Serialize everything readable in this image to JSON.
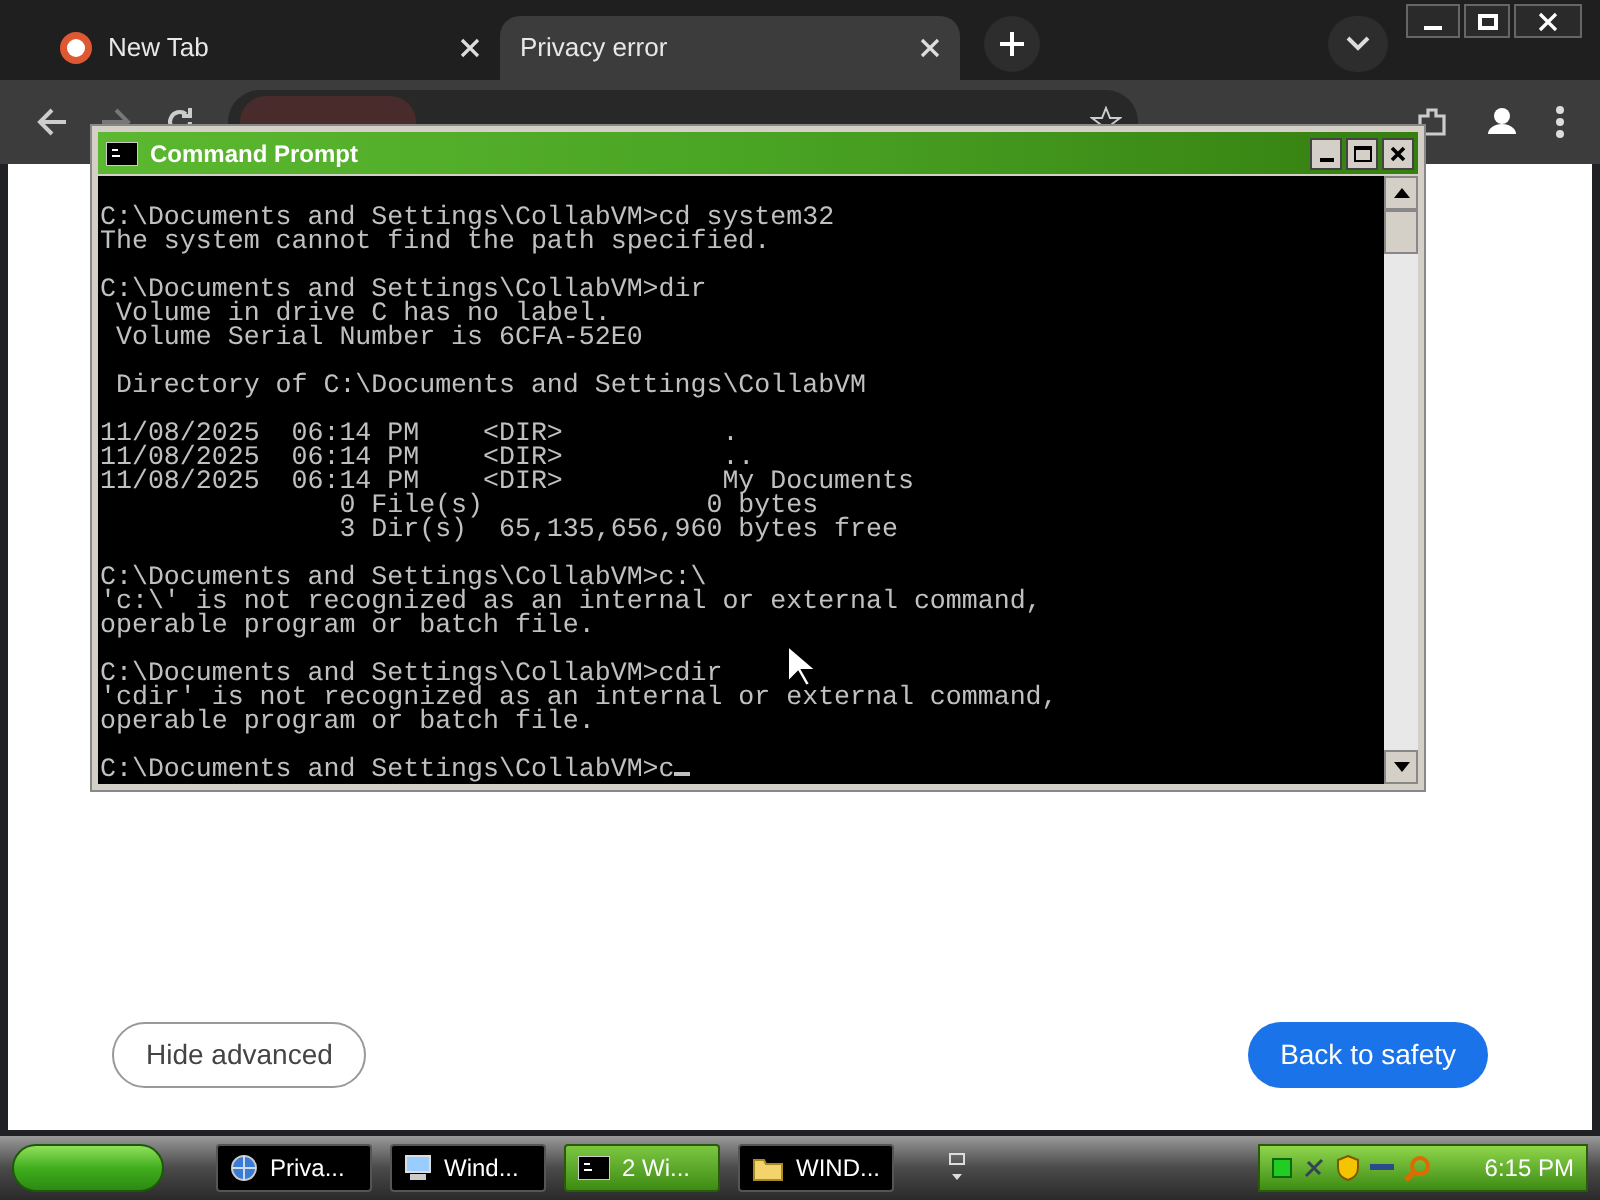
{
  "browser": {
    "tabs": [
      {
        "title": "New Tab",
        "selected": false
      },
      {
        "title": "Privacy error",
        "selected": true
      }
    ]
  },
  "page": {
    "buttons": [
      {
        "label": "Hide advanced",
        "kind": "secondary"
      },
      {
        "label": "Back to safety",
        "kind": "primary"
      }
    ]
  },
  "console_window": {
    "title": "Command Prompt",
    "blocks": [
      [
        "C:\\Documents and Settings\\CollabVM>cd system32",
        "The system cannot find the path specified."
      ],
      [
        "C:\\Documents and Settings\\CollabVM>dir",
        " Volume in drive C has no label.",
        " Volume Serial Number is 6CFA-52E0"
      ],
      [
        " Directory of C:\\Documents and Settings\\CollabVM"
      ],
      [
        "11/08/2025  06:14 PM    <DIR>          .",
        "11/08/2025  06:14 PM    <DIR>          ..",
        "11/08/2025  06:14 PM    <DIR>          My Documents",
        "               0 File(s)              0 bytes",
        "               3 Dir(s)  65,135,656,960 bytes free"
      ],
      [
        "C:\\Documents and Settings\\CollabVM>c:\\",
        "'c:\\' is not recognized as an internal or external command,",
        "operable program or batch file."
      ],
      [
        "C:\\Documents and Settings\\CollabVM>cdir",
        "'cdir' is not recognized as an internal or external command,",
        "operable program or batch file."
      ],
      [
        "C:\\Documents and Settings\\CollabVM>c"
      ]
    ]
  },
  "taskbar": {
    "buttons": [
      {
        "label": "Priva...",
        "kind": "browser",
        "selected": false
      },
      {
        "label": "Wind...",
        "kind": "computer",
        "selected": false
      },
      {
        "label": "2 Wi...",
        "kind": "console",
        "selected": true
      },
      {
        "label": "WIND...",
        "kind": "folder",
        "selected": false
      }
    ],
    "clock": "6:15 PM"
  }
}
